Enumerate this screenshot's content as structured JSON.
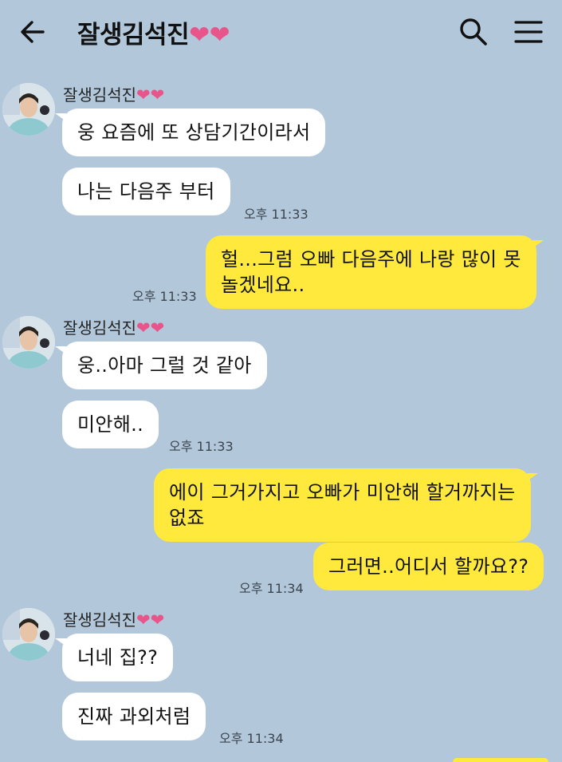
{
  "header": {
    "title": "잘생김석진",
    "title_hearts": "❤❤"
  },
  "chat": {
    "sender_name": "잘생김석진",
    "sender_hearts": "❤❤",
    "messages": [
      {
        "from": "them",
        "text": "웅 요즘에 또 상담기간이라서"
      },
      {
        "from": "them",
        "text": "나는 다음주 부터",
        "time": "오후 11:33"
      },
      {
        "from": "me",
        "lines": [
          "헐...그럼 오빠 다음주에 나랑 많이 못",
          "놀겠네요.."
        ],
        "time": "오후 11:33"
      },
      {
        "from": "them",
        "text": "웅..아마 그럴 것 같아"
      },
      {
        "from": "them",
        "text": "미안해..",
        "time": "오후 11:33"
      },
      {
        "from": "me",
        "lines": [
          "에이 그거가지고 오빠가 미안해 할거까지는",
          "없죠"
        ]
      },
      {
        "from": "me",
        "text": "그러면..어디서 할까요??",
        "time": "오후 11:34"
      },
      {
        "from": "them",
        "text": "너네 집??"
      },
      {
        "from": "them",
        "text": "진짜 과외처럼",
        "time": "오후 11:34"
      }
    ]
  },
  "colors": {
    "background": "#b2c7da",
    "incoming_bubble": "#ffffff",
    "outgoing_bubble": "#fee93c",
    "heart": "#e8558a"
  },
  "icons": [
    "back-arrow-icon",
    "search-icon",
    "menu-icon",
    "avatar"
  ]
}
